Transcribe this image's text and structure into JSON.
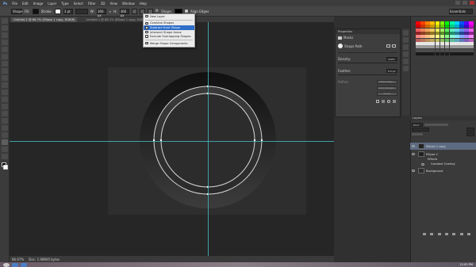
{
  "menu": [
    "Ps",
    "File",
    "Edit",
    "Image",
    "Layer",
    "Type",
    "Select",
    "Filter",
    "3D",
    "View",
    "Window",
    "Help"
  ],
  "options_bar": {
    "tool_mode": "Shape",
    "fill_label": "Fill:",
    "stroke_label": "Stroke:",
    "stroke_width": "3 pt",
    "w_label": "W:",
    "h_label": "H:",
    "w_value": "366 px",
    "h_value": "366 px",
    "shape_label": "Shape:",
    "align_edges": "Align Edges",
    "workspace": "Essentials"
  },
  "tabs": [
    "Untitled-1 @ 66.7% (Ellipse 1 copy, RGB/8)",
    "Untitled-1 @ 66.7% (Ellipse 1 copy, RGB/8)"
  ],
  "path_ops_menu": {
    "items": [
      {
        "label": "New Layer",
        "selected": false
      },
      {
        "label": "Combine Shapes",
        "selected": false
      },
      {
        "label": "Subtract Front Shape",
        "selected": true
      },
      {
        "label": "Intersect Shape Areas",
        "selected": false
      },
      {
        "label": "Exclude Overlapping Shapes",
        "selected": false
      },
      {
        "label": "Merge Shape Components",
        "selected": false
      }
    ]
  },
  "properties": {
    "title": "Properties",
    "subtitle": "Masks",
    "shape_label": "Shape Path",
    "density_label": "Density:",
    "density_value": "100%",
    "feather_label": "Feather:",
    "feather_value": "0.0 px",
    "refine_label": "Refine:",
    "mask_edge_btn": "Mask Edge...",
    "color_range_btn": "Color Range...",
    "invert_btn": "Invert"
  },
  "layers": {
    "title": "Layers",
    "kind_label": "Kind",
    "items": [
      {
        "name": "Ellipse 1 copy",
        "active": true
      },
      {
        "name": "Ellipse 1",
        "active": false
      },
      {
        "name": "Effects",
        "active": false
      },
      {
        "name": "Gradient Overlay",
        "active": false
      },
      {
        "name": "Background",
        "active": false
      }
    ]
  },
  "status": {
    "zoom": "66.67%",
    "doc": "Doc: 1.98M/0 bytes"
  },
  "taskbar": {
    "time": "12:03 PM"
  },
  "colors": {
    "guide": "#45b5b8",
    "selection": "#2e6ec9",
    "layer_active": "#5d6b82"
  }
}
